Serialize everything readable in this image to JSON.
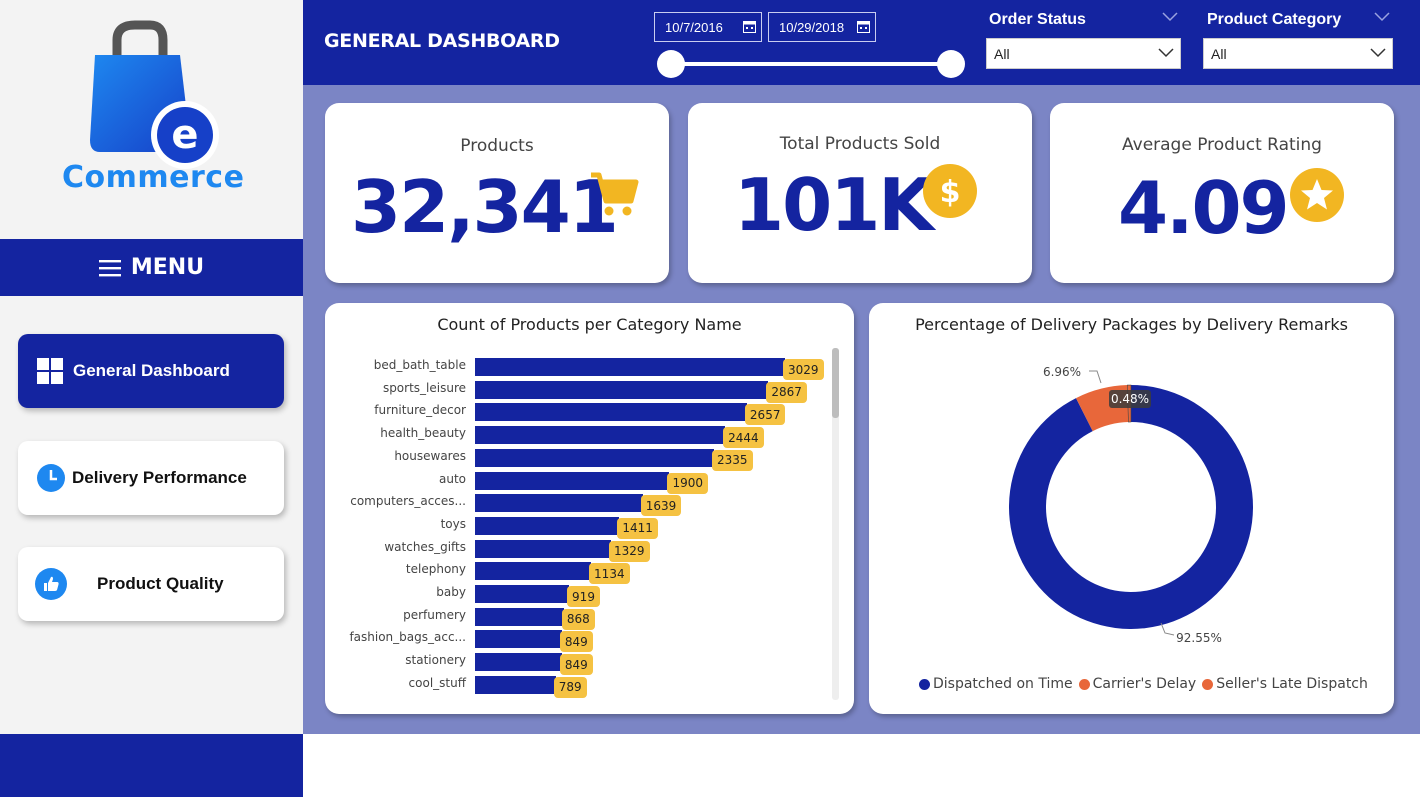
{
  "logo": {
    "text": "Commerce",
    "letter": "e"
  },
  "menu": {
    "label": "MENU"
  },
  "nav": [
    {
      "label": "General Dashboard",
      "active": true,
      "icon": "grid-icon"
    },
    {
      "label": "Delivery Performance",
      "active": false,
      "icon": "clock-icon"
    },
    {
      "label": "Product Quality",
      "active": false,
      "icon": "thumbs-up-icon"
    }
  ],
  "header": {
    "title": "GENERAL DASHBOARD",
    "date_start": "10/7/2016",
    "date_end": "10/29/2018",
    "filters": [
      {
        "label": "Order Status",
        "value": "All"
      },
      {
        "label": "Product Category",
        "value": "All"
      }
    ]
  },
  "kpis": [
    {
      "label": "Products",
      "value": "32,341",
      "icon": "cart-icon"
    },
    {
      "label": "Total Products Sold",
      "value": "101K",
      "icon": "dollar-icon"
    },
    {
      "label": "Average Product Rating",
      "value": "4.09",
      "icon": "star-icon"
    }
  ],
  "colors": {
    "navy": "#1424a0",
    "accent": "#f5c242",
    "canvas": "#7b85c5",
    "orange": "#e8673a"
  },
  "chart_data": [
    {
      "type": "bar",
      "orientation": "horizontal",
      "title": "Count of Products per Category Name",
      "categories": [
        "bed_bath_table",
        "sports_leisure",
        "furniture_decor",
        "health_beauty",
        "housewares",
        "auto",
        "computers_acces...",
        "toys",
        "watches_gifts",
        "telephony",
        "baby",
        "perfumery",
        "fashion_bags_acc...",
        "stationery",
        "cool_stuff"
      ],
      "values": [
        3029,
        2867,
        2657,
        2444,
        2335,
        1900,
        1639,
        1411,
        1329,
        1134,
        919,
        868,
        849,
        849,
        789
      ],
      "value_labels": [
        "3029",
        "2867",
        "2657",
        "2444",
        "2335",
        "1900",
        "1639",
        "1411",
        "1329",
        "1134",
        "919",
        "868",
        "849",
        "849",
        "789"
      ],
      "xlim": [
        0,
        3029
      ]
    },
    {
      "type": "pie",
      "variant": "donut",
      "title": "Percentage of Delivery Packages by Delivery Remarks",
      "categories": [
        "Dispatched on Time",
        "Carrier's Delay",
        "Seller's Late Dispatch"
      ],
      "values": [
        92.55,
        6.96,
        0.48
      ],
      "value_labels": [
        "92.55%",
        "6.96%",
        "0.48%"
      ],
      "colors": [
        "#1424a0",
        "#e8673a",
        "#e8673a"
      ],
      "legend": "bottom"
    }
  ]
}
